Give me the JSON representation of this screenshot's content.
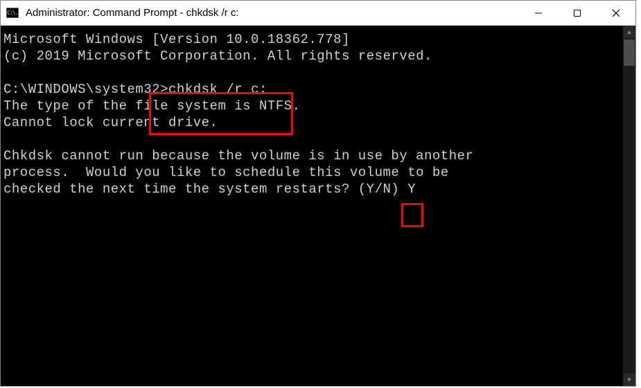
{
  "titlebar": {
    "icon_text": "C:\\.",
    "title": "Administrator: Command Prompt - chkdsk  /r c:"
  },
  "console": {
    "line1": "Microsoft Windows [Version 10.0.18362.778]",
    "line2": "(c) 2019 Microsoft Corporation. All rights reserved.",
    "line3": "",
    "prompt": "C:\\WINDOWS\\system32>",
    "command": "chkdsk /r c:",
    "line5": "The type of the file system is NTFS.",
    "line6": "Cannot lock current drive.",
    "line7": "",
    "line8": "Chkdsk cannot run because the volume is in use by another",
    "line9": "process.  Would you like to schedule this volume to be",
    "line10_prefix": "checked the next time the system restarts? (Y/N) ",
    "user_input": "Y"
  }
}
